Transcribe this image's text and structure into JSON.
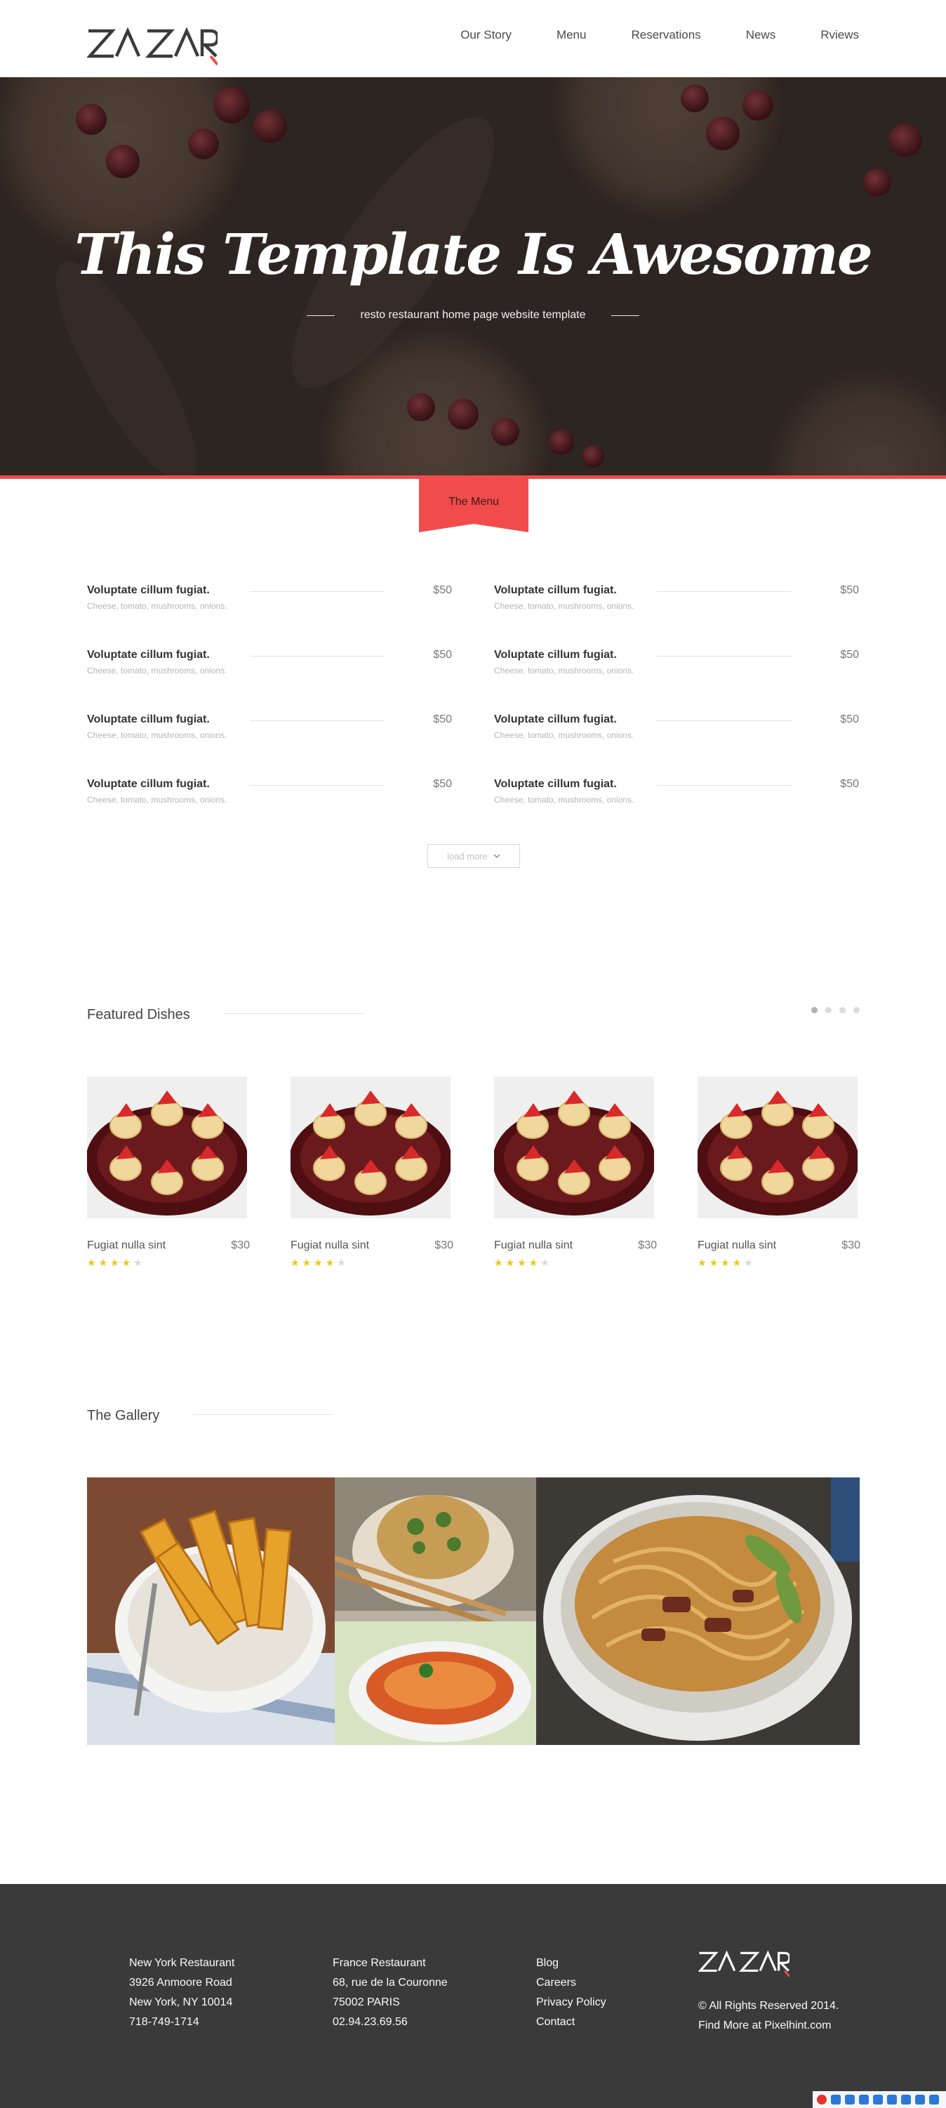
{
  "header": {
    "logo_text": "ZAZAR",
    "nav": [
      "Our Story",
      "Menu",
      "Reservations",
      "News",
      "Rviews"
    ]
  },
  "hero": {
    "title": "This Template Is Awesome",
    "subtitle": "resto restaurant home page website template"
  },
  "menu": {
    "tab_label": "The Menu",
    "items": [
      {
        "name": "Voluptate cillum fugiat.",
        "desc": "Cheese, tomato, mushrooms, onions.",
        "price": "$50"
      },
      {
        "name": "Voluptate cillum fugiat.",
        "desc": "Cheese, tomato, mushrooms, onions.",
        "price": "$50"
      },
      {
        "name": "Voluptate cillum fugiat.",
        "desc": "Cheese, tomato, mushrooms, onions.",
        "price": "$50"
      },
      {
        "name": "Voluptate cillum fugiat.",
        "desc": "Cheese, tomato, mushrooms, onions.",
        "price": "$50"
      },
      {
        "name": "Voluptate cillum fugiat.",
        "desc": "Cheese, tomato, mushrooms, onions.",
        "price": "$50"
      },
      {
        "name": "Voluptate cillum fugiat.",
        "desc": "Cheese, tomato, mushrooms, onions.",
        "price": "$50"
      },
      {
        "name": "Voluptate cillum fugiat.",
        "desc": "Cheese, tomato, mushrooms, onions.",
        "price": "$50"
      },
      {
        "name": "Voluptate cillum fugiat.",
        "desc": "Cheese, tomato, mushrooms, onions.",
        "price": "$50"
      }
    ],
    "load_more": "load more",
    "load_more_icon": "chevron-down-icon"
  },
  "featured": {
    "title": "Featured Dishes",
    "dots_active": 1,
    "dots_total": 4,
    "dishes": [
      {
        "name": "Fugiat nulla sint",
        "price": "$30",
        "rating": 4,
        "max": 5
      },
      {
        "name": "Fugiat nulla sint",
        "price": "$30",
        "rating": 4,
        "max": 5
      },
      {
        "name": "Fugiat nulla sint",
        "price": "$30",
        "rating": 4,
        "max": 5
      },
      {
        "name": "Fugiat nulla sint",
        "price": "$30",
        "rating": 4,
        "max": 5
      }
    ]
  },
  "gallery": {
    "title": "The Gallery"
  },
  "footer": {
    "col1": [
      "New York Restaurant",
      "3926 Anmoore Road",
      "New York, NY 10014",
      "718-749-1714"
    ],
    "col2": [
      "France Restaurant",
      "68, rue de la Couronne",
      "75002 PARIS",
      "02.94.23.69.56"
    ],
    "links": [
      "Blog",
      "Careers",
      "Privacy Policy",
      "Contact"
    ],
    "copyright": "© All Rights Reserved 2014.",
    "find_more": "Find More at Pixelhint.com"
  },
  "colors": {
    "accent": "#f24b4b",
    "footer_bg": "#3a3a3b",
    "star": "#f2c60f"
  }
}
